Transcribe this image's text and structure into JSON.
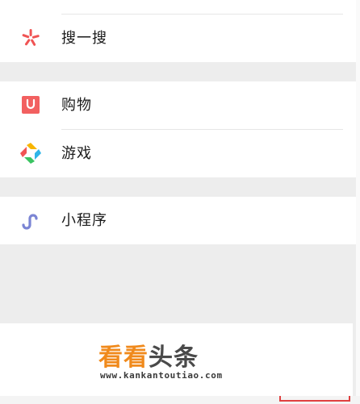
{
  "menu": {
    "search": {
      "label": "搜一搜",
      "icon": "search-spark-icon",
      "color": "#f05454"
    },
    "shopping": {
      "label": "购物",
      "icon": "shopping-bag-icon",
      "color": "#f26060"
    },
    "games": {
      "label": "游戏",
      "icon": "game-pinwheel-icon",
      "colors": [
        "#f7b500",
        "#2fb5e8",
        "#3ac461",
        "#f05454"
      ]
    },
    "miniprogram": {
      "label": "小程序",
      "icon": "mini-program-icon",
      "color": "#7b85d4"
    }
  },
  "watermark": {
    "brand_part1": "看看",
    "brand_part2": "头条",
    "url": "www.kankantoutiao.com"
  }
}
